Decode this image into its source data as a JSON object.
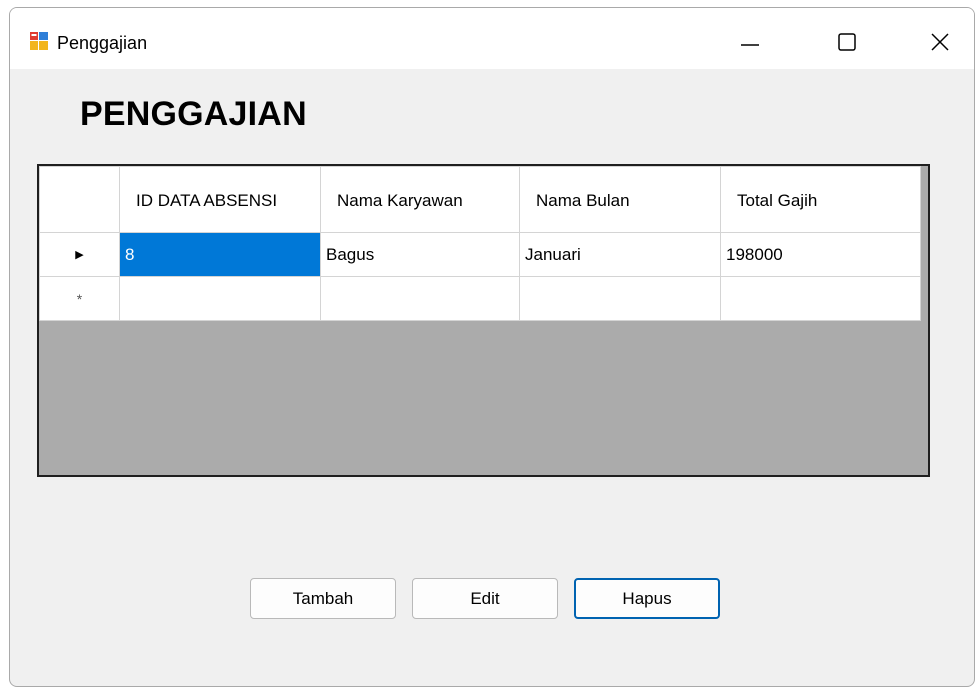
{
  "window": {
    "title": "Penggajian",
    "icon": "winforms-app-icon",
    "controls": {
      "minimize": "minimize-icon",
      "maximize": "maximize-icon",
      "close": "close-icon"
    }
  },
  "form": {
    "heading": "PENGGAJIAN"
  },
  "grid": {
    "columns": [
      "ID DATA ABSENSI",
      "Nama Karyawan",
      "Nama Bulan",
      "Total Gajih"
    ],
    "rows": [
      {
        "indicator": "▶",
        "cells": [
          "8",
          "Bagus",
          "Januari",
          "198000"
        ],
        "selected_cell_index": 0
      },
      {
        "indicator": "*",
        "cells": [
          "",
          "",
          "",
          ""
        ]
      }
    ]
  },
  "buttons": {
    "tambah": "Tambah",
    "edit": "Edit",
    "hapus": "Hapus"
  },
  "colors": {
    "selection": "#0078d7",
    "grid_background": "#ababab",
    "focus_border": "#0063b1"
  }
}
